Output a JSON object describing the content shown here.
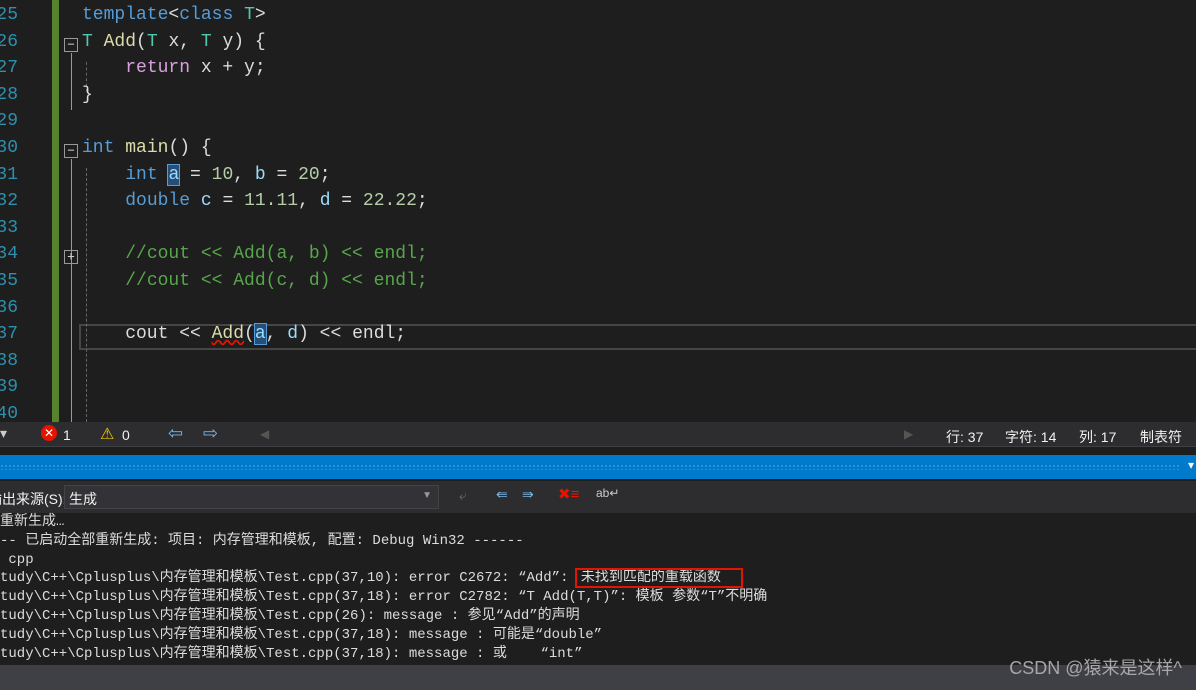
{
  "editor": {
    "line_numbers": [
      "25",
      "26",
      "27",
      "28",
      "29",
      "30",
      "31",
      "32",
      "33",
      "34",
      "35",
      "36",
      "37",
      "38",
      "39",
      "40"
    ],
    "lines": [
      [
        [
          "template",
          "kw"
        ],
        [
          "<",
          "p"
        ],
        [
          "class",
          "kw"
        ],
        [
          " ",
          "p"
        ],
        [
          "T",
          "ty"
        ],
        [
          ">",
          "p"
        ]
      ],
      [
        [
          "T",
          "ty"
        ],
        [
          " ",
          "p"
        ],
        [
          "Add",
          "fn"
        ],
        [
          "(",
          "p"
        ],
        [
          "T",
          "ty"
        ],
        [
          " x, ",
          "p"
        ],
        [
          "T",
          "ty"
        ],
        [
          " y) {",
          "p"
        ]
      ],
      [
        [
          "    ",
          "p"
        ],
        [
          "return",
          "ret"
        ],
        [
          " x + y;",
          "p"
        ]
      ],
      [
        [
          "}",
          "p"
        ]
      ],
      [],
      [
        [
          "int",
          "kw"
        ],
        [
          " ",
          "p"
        ],
        [
          "main",
          "fn"
        ],
        [
          "() {",
          "p"
        ]
      ],
      [
        [
          "    ",
          "p"
        ],
        [
          "int",
          "kw"
        ],
        [
          " ",
          "p"
        ],
        [
          "a",
          "varhl"
        ],
        [
          " = ",
          "p"
        ],
        [
          "10",
          "num"
        ],
        [
          ", ",
          "p"
        ],
        [
          "b",
          "var"
        ],
        [
          " = ",
          "p"
        ],
        [
          "20",
          "num"
        ],
        [
          ";",
          "p"
        ]
      ],
      [
        [
          "    ",
          "p"
        ],
        [
          "double",
          "kw"
        ],
        [
          " ",
          "p"
        ],
        [
          "c",
          "var"
        ],
        [
          " = ",
          "p"
        ],
        [
          "11.11",
          "num"
        ],
        [
          ", ",
          "p"
        ],
        [
          "d",
          "var"
        ],
        [
          " = ",
          "p"
        ],
        [
          "22.22",
          "num"
        ],
        [
          ";",
          "p"
        ]
      ],
      [],
      [
        [
          "    ",
          "p"
        ],
        [
          "//cout << Add(a, b) << endl;",
          "cm"
        ]
      ],
      [
        [
          "    ",
          "p"
        ],
        [
          "//cout << Add(c, d) << endl;",
          "cm"
        ]
      ],
      [],
      [
        [
          "    cout << ",
          "p"
        ],
        [
          "Add",
          "fnerr"
        ],
        [
          "(",
          "p"
        ],
        [
          "a",
          "varhl"
        ],
        [
          ", ",
          "p"
        ],
        [
          "d",
          "var"
        ],
        [
          ") << endl;",
          "p"
        ]
      ],
      [],
      [],
      []
    ]
  },
  "status": {
    "errors": "1",
    "warnings": "0",
    "line": "行: 37",
    "char": "字符: 14",
    "col": "列: 17",
    "tab": "制表符"
  },
  "output": {
    "source_label": "输出来源(S):",
    "source_value": "生成",
    "lines": [
      "重新生成…",
      "-- 已启动全部重新生成: 项目: 内存管理和模板, 配置: Debug Win32 ------",
      " cpp",
      "tudy\\C++\\Cplusplus\\内存管理和模板\\Test.cpp(37,10): error C2672: “Add”: ",
      "tudy\\C++\\Cplusplus\\内存管理和模板\\Test.cpp(37,18): error C2782: “T Add(T,T)”: 模板 参数“T”不明确",
      "tudy\\C++\\Cplusplus\\内存管理和模板\\Test.cpp(26): message : 参见“Add”的声明",
      "tudy\\C++\\Cplusplus\\内存管理和模板\\Test.cpp(37,18): message : 可能是“double”",
      "tudy\\C++\\Cplusplus\\内存管理和模板\\Test.cpp(37,18): message : 或    “int”"
    ],
    "highlighted": "未找到匹配的重载函数"
  },
  "watermark": "CSDN @猿来是这样^",
  "colors": {
    "kw": "#569cd6",
    "ty": "#4ec9b0",
    "fn": "#dcdcaa",
    "ret": "#d8a0df",
    "num": "#b5cea8",
    "cm": "#57a64a",
    "var": "#9cdcfe",
    "p": "#dcdcdc",
    "accent": "#007acc",
    "highlight_box": "#e51400"
  }
}
